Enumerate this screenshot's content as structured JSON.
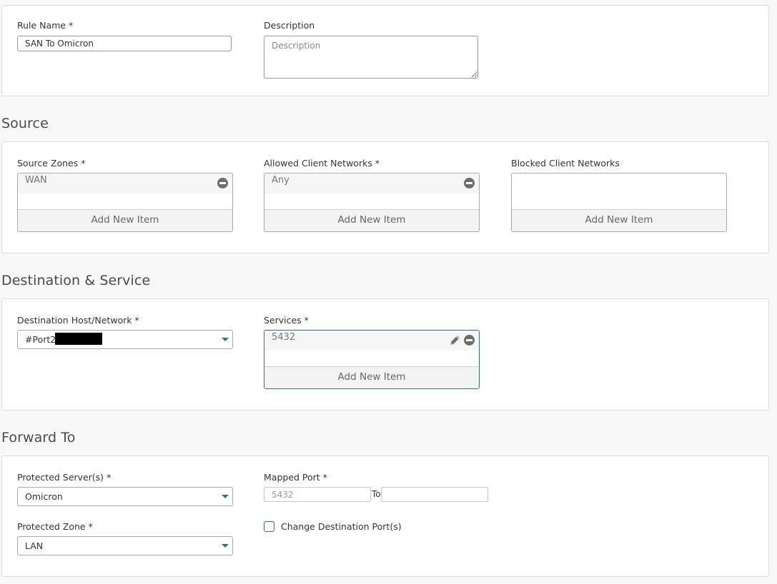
{
  "general": {
    "rule_name_label": "Rule Name *",
    "rule_name_value": "SAN To Omicron",
    "description_label": "Description",
    "description_placeholder": "Description"
  },
  "source": {
    "title": "Source",
    "source_zones_label": "Source Zones *",
    "source_zones_items": [
      "WAN"
    ],
    "allowed_networks_label": "Allowed Client Networks *",
    "allowed_networks_items": [
      "Any"
    ],
    "blocked_networks_label": "Blocked Client Networks",
    "add_new_item": "Add New Item"
  },
  "destination": {
    "title": "Destination & Service",
    "host_label": "Destination Host/Network *",
    "host_value": "#Port2",
    "services_label": "Services *",
    "services_items": [
      "5432"
    ],
    "add_new_item": "Add New Item"
  },
  "forward": {
    "title": "Forward To",
    "protected_servers_label": "Protected Server(s) *",
    "protected_servers_value": "Omicron",
    "mapped_port_label": "Mapped Port *",
    "mapped_port_from_placeholder": "5432",
    "mapped_port_to_label": "To",
    "protected_zone_label": "Protected Zone *",
    "protected_zone_value": "LAN",
    "change_dest_port_label": "Change Destination Port(s)"
  },
  "colors": {
    "accent": "#2a6e9c",
    "panel_border": "#dcdcdc",
    "page_background": "#f8f8f8"
  }
}
